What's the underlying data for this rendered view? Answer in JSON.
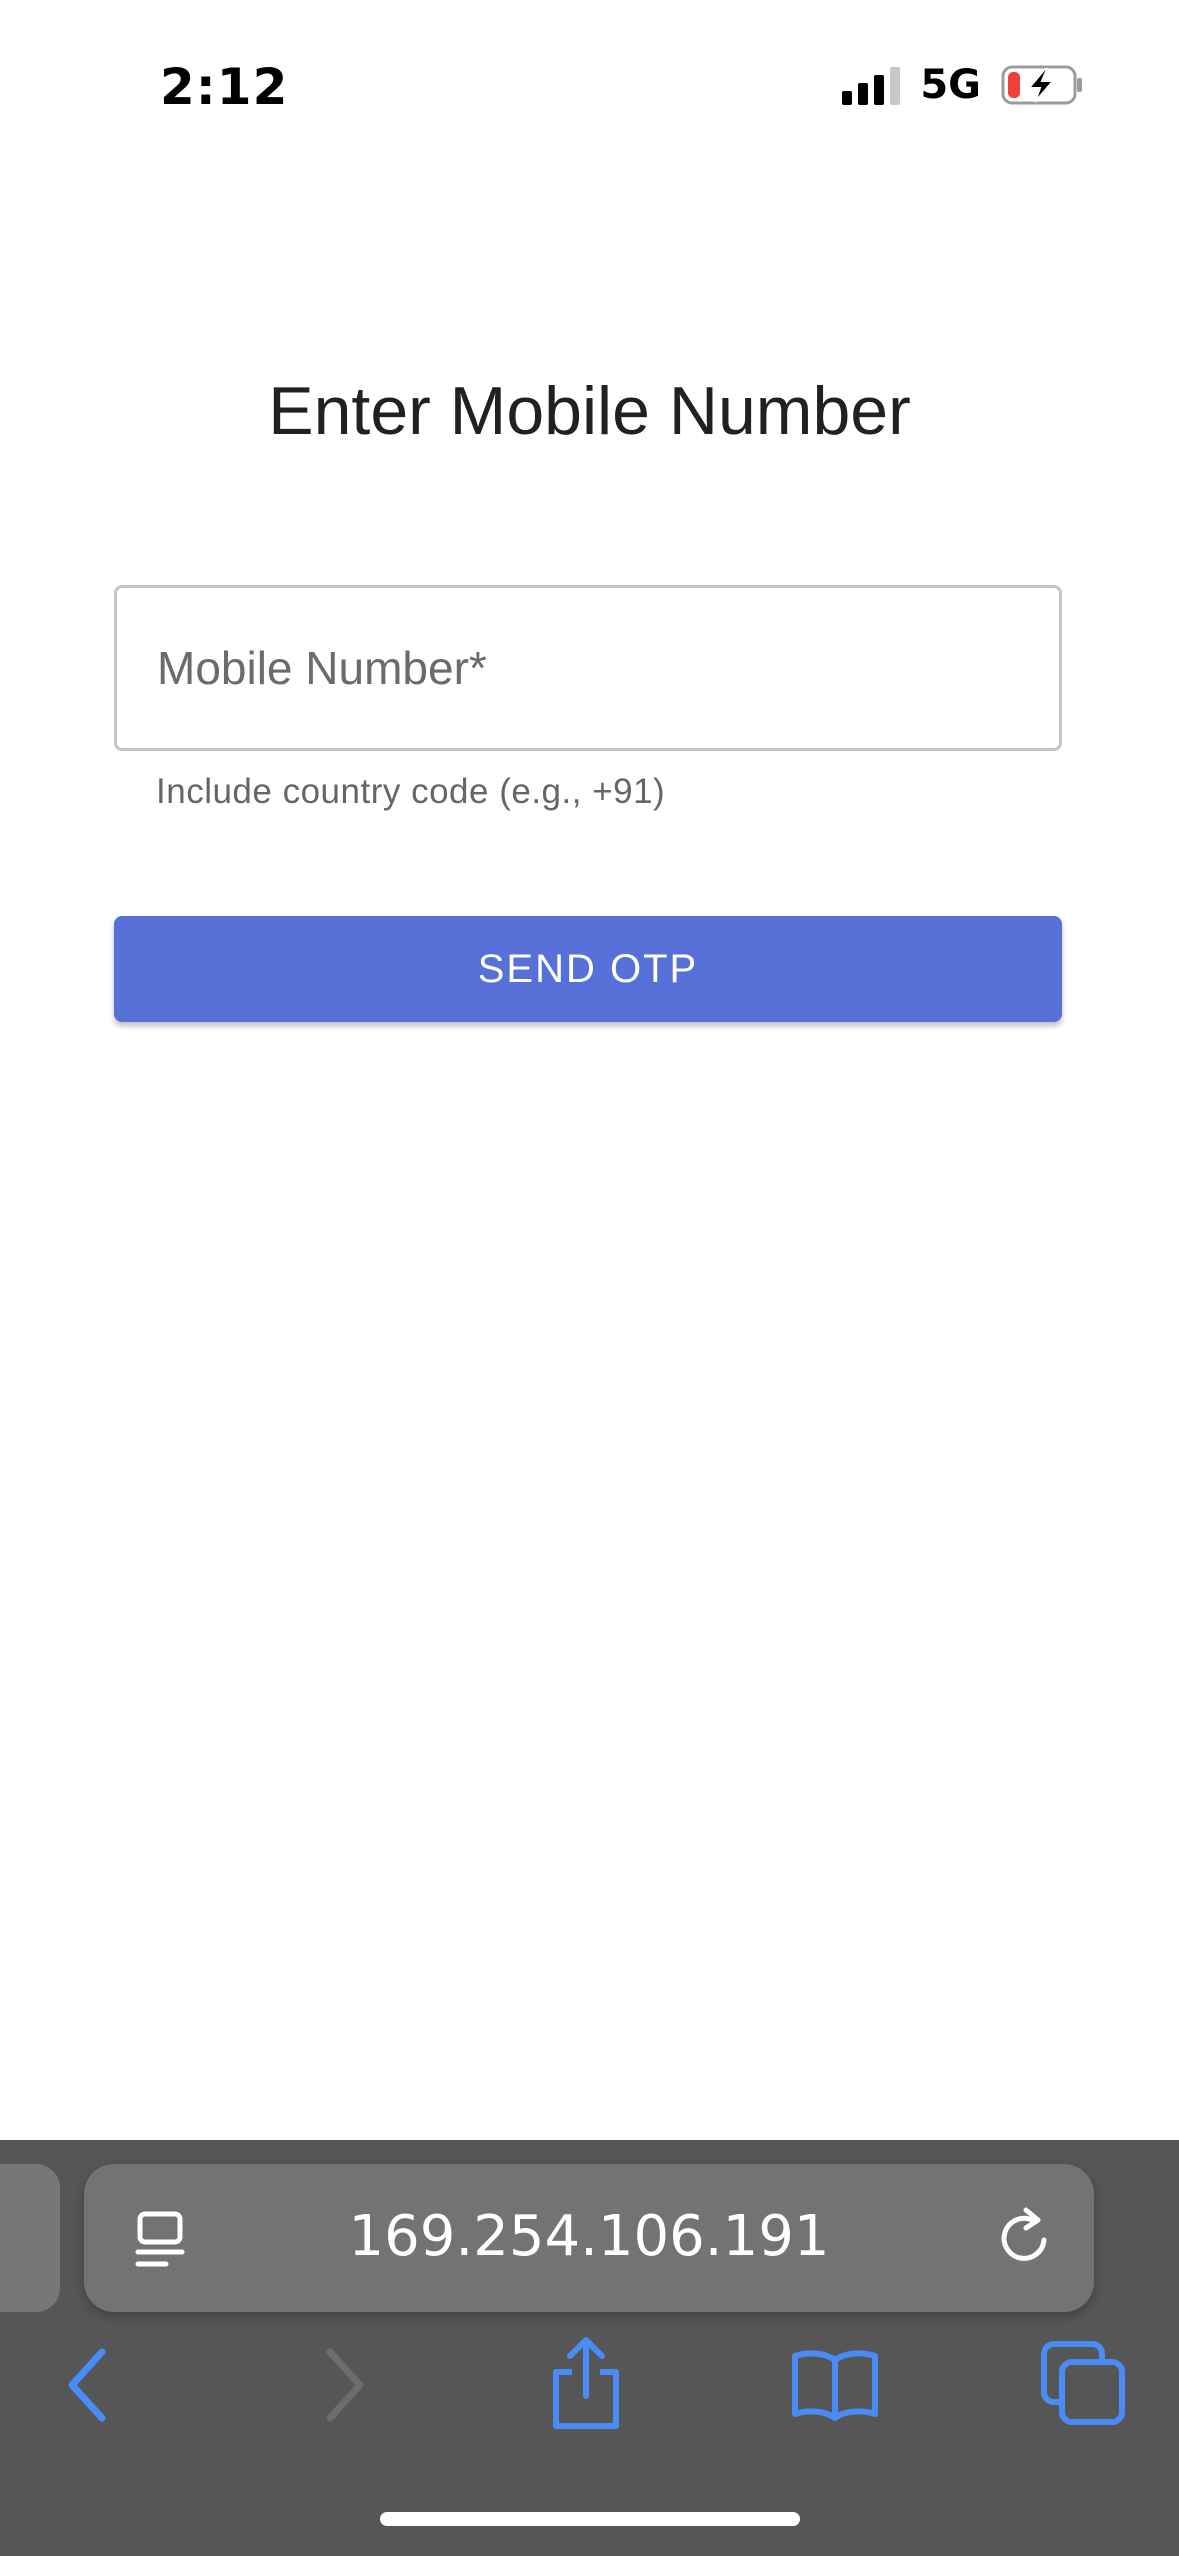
{
  "status_bar": {
    "time": "2:12",
    "network": "5G"
  },
  "page": {
    "title": "Enter Mobile Number",
    "mobile_field": {
      "placeholder": "Mobile Number*",
      "value": ""
    },
    "helper_text": "Include country code (e.g., +91)",
    "send_button_label": "SEND OTP"
  },
  "browser": {
    "address": "169.254.106.191",
    "icons": {
      "page_menu": "page-format-icon",
      "reload": "reload-icon",
      "back": "back-icon",
      "forward": "forward-icon",
      "share": "share-icon",
      "bookmarks": "bookmarks-icon",
      "tabs": "tabs-icon"
    }
  },
  "colors": {
    "primary_button": "#5670d7",
    "toolbar_bg": "#565656",
    "toolbar_accent": "#4a8cf7"
  }
}
